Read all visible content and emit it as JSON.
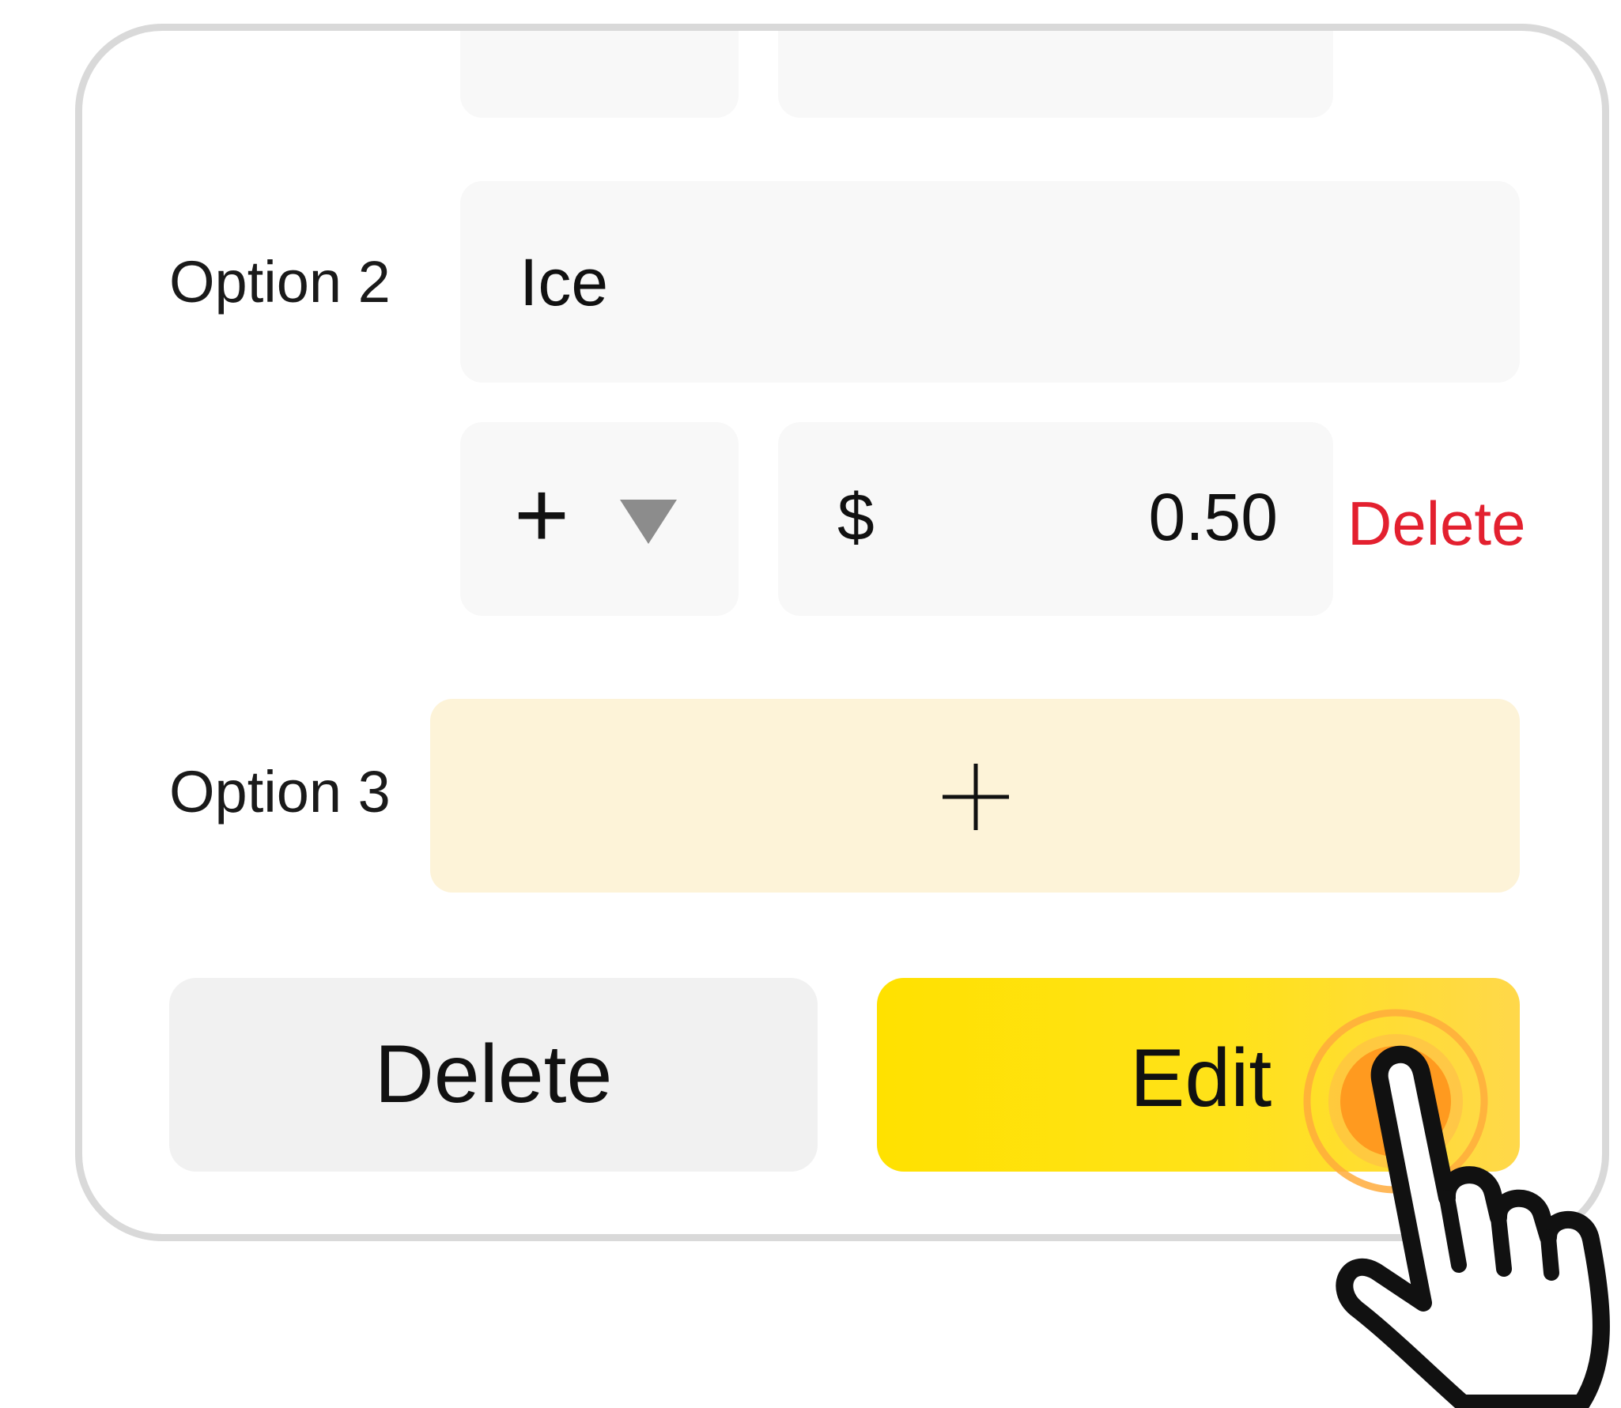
{
  "options": [
    {
      "label": "Option 2",
      "name": "Ice",
      "operator": "+",
      "currency": "$",
      "price": "0.50",
      "delete_label": "Delete"
    },
    {
      "label": "Option 3",
      "add_icon": "plus-icon"
    }
  ],
  "actions": {
    "delete_label": "Delete",
    "edit_label": "Edit"
  },
  "colors": {
    "accent_yellow": "#FFE100",
    "add_box_bg": "#FDF3D8",
    "danger": "#E3202F",
    "tap_indicator": "#FF9A1F"
  },
  "icons": {
    "dropdown": "chevron-down-icon",
    "cursor": "hand-pointer-icon"
  }
}
